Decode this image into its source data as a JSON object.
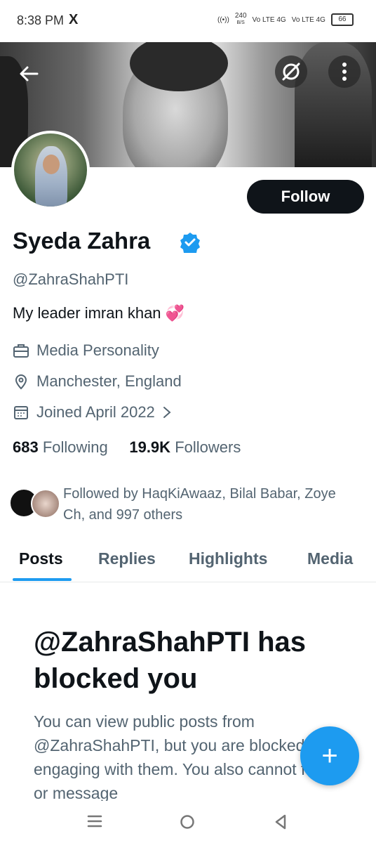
{
  "status_bar": {
    "time": "8:38 PM",
    "app_icon": "X",
    "net_speed_value": "240",
    "net_speed_unit": "B/S",
    "sim1": "Vo LTE 4G",
    "sim2": "Vo LTE 4G",
    "battery": "66"
  },
  "header": {
    "back_icon": "back-arrow-icon",
    "grok_icon": "grok-icon",
    "more_icon": "more-vertical-icon"
  },
  "profile": {
    "follow_label": "Follow",
    "name": "Syeda Zahra",
    "handle": "@ZahraShahPTI",
    "bio": "My leader imran khan 💞",
    "category": "Media Personality",
    "location": "Manchester, England",
    "joined": "Joined April 2022",
    "following_count": "683",
    "following_label": "Following",
    "followers_count": "19.9K",
    "followers_label": "Followers",
    "followed_by": "Followed by HaqKiAwaaz, Bilal Babar, Zoye Ch, and 997 others"
  },
  "tabs": [
    {
      "label": "Posts",
      "active": true
    },
    {
      "label": "Replies",
      "active": false
    },
    {
      "label": "Highlights",
      "active": false
    },
    {
      "label": "Media",
      "active": false
    }
  ],
  "blocked": {
    "title": "@ZahraShahPTI has blocked you",
    "body": "You can view public posts from @ZahraShahPTI, but you are blocked from engaging with them. You also cannot follow or message"
  },
  "fab": {
    "symbol": "+"
  },
  "colors": {
    "accent": "#1d9bf0",
    "text": "#0f1419",
    "secondary": "#536471",
    "button": "#0f1419"
  }
}
